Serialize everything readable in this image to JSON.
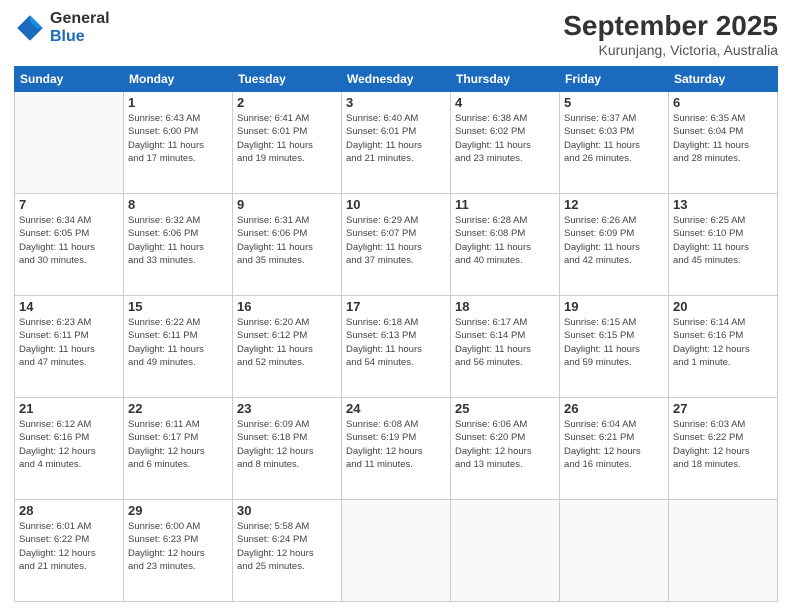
{
  "logo": {
    "line1": "General",
    "line2": "Blue"
  },
  "title": "September 2025",
  "location": "Kurunjang, Victoria, Australia",
  "weekdays": [
    "Sunday",
    "Monday",
    "Tuesday",
    "Wednesday",
    "Thursday",
    "Friday",
    "Saturday"
  ],
  "weeks": [
    [
      {
        "day": "",
        "info": ""
      },
      {
        "day": "1",
        "info": "Sunrise: 6:43 AM\nSunset: 6:00 PM\nDaylight: 11 hours\nand 17 minutes."
      },
      {
        "day": "2",
        "info": "Sunrise: 6:41 AM\nSunset: 6:01 PM\nDaylight: 11 hours\nand 19 minutes."
      },
      {
        "day": "3",
        "info": "Sunrise: 6:40 AM\nSunset: 6:01 PM\nDaylight: 11 hours\nand 21 minutes."
      },
      {
        "day": "4",
        "info": "Sunrise: 6:38 AM\nSunset: 6:02 PM\nDaylight: 11 hours\nand 23 minutes."
      },
      {
        "day": "5",
        "info": "Sunrise: 6:37 AM\nSunset: 6:03 PM\nDaylight: 11 hours\nand 26 minutes."
      },
      {
        "day": "6",
        "info": "Sunrise: 6:35 AM\nSunset: 6:04 PM\nDaylight: 11 hours\nand 28 minutes."
      }
    ],
    [
      {
        "day": "7",
        "info": "Sunrise: 6:34 AM\nSunset: 6:05 PM\nDaylight: 11 hours\nand 30 minutes."
      },
      {
        "day": "8",
        "info": "Sunrise: 6:32 AM\nSunset: 6:06 PM\nDaylight: 11 hours\nand 33 minutes."
      },
      {
        "day": "9",
        "info": "Sunrise: 6:31 AM\nSunset: 6:06 PM\nDaylight: 11 hours\nand 35 minutes."
      },
      {
        "day": "10",
        "info": "Sunrise: 6:29 AM\nSunset: 6:07 PM\nDaylight: 11 hours\nand 37 minutes."
      },
      {
        "day": "11",
        "info": "Sunrise: 6:28 AM\nSunset: 6:08 PM\nDaylight: 11 hours\nand 40 minutes."
      },
      {
        "day": "12",
        "info": "Sunrise: 6:26 AM\nSunset: 6:09 PM\nDaylight: 11 hours\nand 42 minutes."
      },
      {
        "day": "13",
        "info": "Sunrise: 6:25 AM\nSunset: 6:10 PM\nDaylight: 11 hours\nand 45 minutes."
      }
    ],
    [
      {
        "day": "14",
        "info": "Sunrise: 6:23 AM\nSunset: 6:11 PM\nDaylight: 11 hours\nand 47 minutes."
      },
      {
        "day": "15",
        "info": "Sunrise: 6:22 AM\nSunset: 6:11 PM\nDaylight: 11 hours\nand 49 minutes."
      },
      {
        "day": "16",
        "info": "Sunrise: 6:20 AM\nSunset: 6:12 PM\nDaylight: 11 hours\nand 52 minutes."
      },
      {
        "day": "17",
        "info": "Sunrise: 6:18 AM\nSunset: 6:13 PM\nDaylight: 11 hours\nand 54 minutes."
      },
      {
        "day": "18",
        "info": "Sunrise: 6:17 AM\nSunset: 6:14 PM\nDaylight: 11 hours\nand 56 minutes."
      },
      {
        "day": "19",
        "info": "Sunrise: 6:15 AM\nSunset: 6:15 PM\nDaylight: 11 hours\nand 59 minutes."
      },
      {
        "day": "20",
        "info": "Sunrise: 6:14 AM\nSunset: 6:16 PM\nDaylight: 12 hours\nand 1 minute."
      }
    ],
    [
      {
        "day": "21",
        "info": "Sunrise: 6:12 AM\nSunset: 6:16 PM\nDaylight: 12 hours\nand 4 minutes."
      },
      {
        "day": "22",
        "info": "Sunrise: 6:11 AM\nSunset: 6:17 PM\nDaylight: 12 hours\nand 6 minutes."
      },
      {
        "day": "23",
        "info": "Sunrise: 6:09 AM\nSunset: 6:18 PM\nDaylight: 12 hours\nand 8 minutes."
      },
      {
        "day": "24",
        "info": "Sunrise: 6:08 AM\nSunset: 6:19 PM\nDaylight: 12 hours\nand 11 minutes."
      },
      {
        "day": "25",
        "info": "Sunrise: 6:06 AM\nSunset: 6:20 PM\nDaylight: 12 hours\nand 13 minutes."
      },
      {
        "day": "26",
        "info": "Sunrise: 6:04 AM\nSunset: 6:21 PM\nDaylight: 12 hours\nand 16 minutes."
      },
      {
        "day": "27",
        "info": "Sunrise: 6:03 AM\nSunset: 6:22 PM\nDaylight: 12 hours\nand 18 minutes."
      }
    ],
    [
      {
        "day": "28",
        "info": "Sunrise: 6:01 AM\nSunset: 6:22 PM\nDaylight: 12 hours\nand 21 minutes."
      },
      {
        "day": "29",
        "info": "Sunrise: 6:00 AM\nSunset: 6:23 PM\nDaylight: 12 hours\nand 23 minutes."
      },
      {
        "day": "30",
        "info": "Sunrise: 5:58 AM\nSunset: 6:24 PM\nDaylight: 12 hours\nand 25 minutes."
      },
      {
        "day": "",
        "info": ""
      },
      {
        "day": "",
        "info": ""
      },
      {
        "day": "",
        "info": ""
      },
      {
        "day": "",
        "info": ""
      }
    ]
  ]
}
